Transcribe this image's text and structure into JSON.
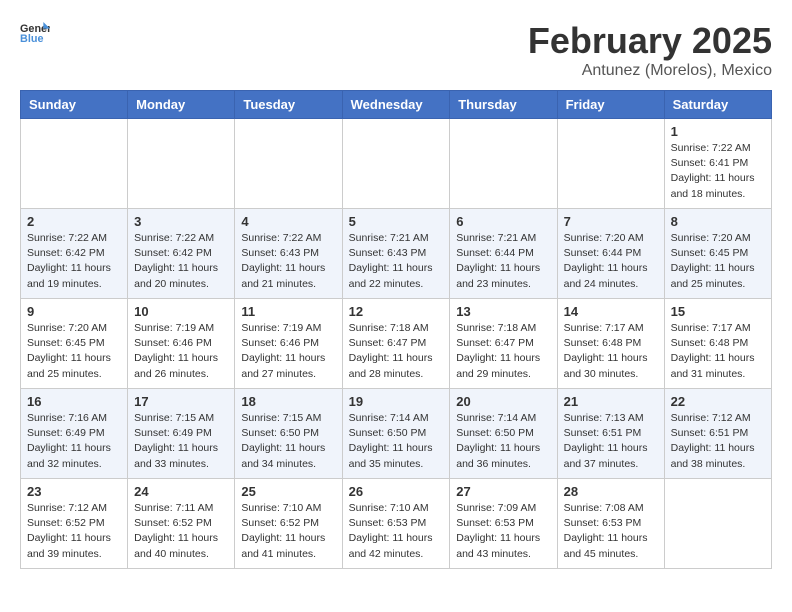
{
  "logo": {
    "general": "General",
    "blue": "Blue"
  },
  "header": {
    "month": "February 2025",
    "location": "Antunez (Morelos), Mexico"
  },
  "weekdays": [
    "Sunday",
    "Monday",
    "Tuesday",
    "Wednesday",
    "Thursday",
    "Friday",
    "Saturday"
  ],
  "weeks": [
    [
      {
        "day": "",
        "info": ""
      },
      {
        "day": "",
        "info": ""
      },
      {
        "day": "",
        "info": ""
      },
      {
        "day": "",
        "info": ""
      },
      {
        "day": "",
        "info": ""
      },
      {
        "day": "",
        "info": ""
      },
      {
        "day": "1",
        "info": "Sunrise: 7:22 AM\nSunset: 6:41 PM\nDaylight: 11 hours and 18 minutes."
      }
    ],
    [
      {
        "day": "2",
        "info": "Sunrise: 7:22 AM\nSunset: 6:42 PM\nDaylight: 11 hours and 19 minutes."
      },
      {
        "day": "3",
        "info": "Sunrise: 7:22 AM\nSunset: 6:42 PM\nDaylight: 11 hours and 20 minutes."
      },
      {
        "day": "4",
        "info": "Sunrise: 7:22 AM\nSunset: 6:43 PM\nDaylight: 11 hours and 21 minutes."
      },
      {
        "day": "5",
        "info": "Sunrise: 7:21 AM\nSunset: 6:43 PM\nDaylight: 11 hours and 22 minutes."
      },
      {
        "day": "6",
        "info": "Sunrise: 7:21 AM\nSunset: 6:44 PM\nDaylight: 11 hours and 23 minutes."
      },
      {
        "day": "7",
        "info": "Sunrise: 7:20 AM\nSunset: 6:44 PM\nDaylight: 11 hours and 24 minutes."
      },
      {
        "day": "8",
        "info": "Sunrise: 7:20 AM\nSunset: 6:45 PM\nDaylight: 11 hours and 25 minutes."
      }
    ],
    [
      {
        "day": "9",
        "info": "Sunrise: 7:20 AM\nSunset: 6:45 PM\nDaylight: 11 hours and 25 minutes."
      },
      {
        "day": "10",
        "info": "Sunrise: 7:19 AM\nSunset: 6:46 PM\nDaylight: 11 hours and 26 minutes."
      },
      {
        "day": "11",
        "info": "Sunrise: 7:19 AM\nSunset: 6:46 PM\nDaylight: 11 hours and 27 minutes."
      },
      {
        "day": "12",
        "info": "Sunrise: 7:18 AM\nSunset: 6:47 PM\nDaylight: 11 hours and 28 minutes."
      },
      {
        "day": "13",
        "info": "Sunrise: 7:18 AM\nSunset: 6:47 PM\nDaylight: 11 hours and 29 minutes."
      },
      {
        "day": "14",
        "info": "Sunrise: 7:17 AM\nSunset: 6:48 PM\nDaylight: 11 hours and 30 minutes."
      },
      {
        "day": "15",
        "info": "Sunrise: 7:17 AM\nSunset: 6:48 PM\nDaylight: 11 hours and 31 minutes."
      }
    ],
    [
      {
        "day": "16",
        "info": "Sunrise: 7:16 AM\nSunset: 6:49 PM\nDaylight: 11 hours and 32 minutes."
      },
      {
        "day": "17",
        "info": "Sunrise: 7:15 AM\nSunset: 6:49 PM\nDaylight: 11 hours and 33 minutes."
      },
      {
        "day": "18",
        "info": "Sunrise: 7:15 AM\nSunset: 6:50 PM\nDaylight: 11 hours and 34 minutes."
      },
      {
        "day": "19",
        "info": "Sunrise: 7:14 AM\nSunset: 6:50 PM\nDaylight: 11 hours and 35 minutes."
      },
      {
        "day": "20",
        "info": "Sunrise: 7:14 AM\nSunset: 6:50 PM\nDaylight: 11 hours and 36 minutes."
      },
      {
        "day": "21",
        "info": "Sunrise: 7:13 AM\nSunset: 6:51 PM\nDaylight: 11 hours and 37 minutes."
      },
      {
        "day": "22",
        "info": "Sunrise: 7:12 AM\nSunset: 6:51 PM\nDaylight: 11 hours and 38 minutes."
      }
    ],
    [
      {
        "day": "23",
        "info": "Sunrise: 7:12 AM\nSunset: 6:52 PM\nDaylight: 11 hours and 39 minutes."
      },
      {
        "day": "24",
        "info": "Sunrise: 7:11 AM\nSunset: 6:52 PM\nDaylight: 11 hours and 40 minutes."
      },
      {
        "day": "25",
        "info": "Sunrise: 7:10 AM\nSunset: 6:52 PM\nDaylight: 11 hours and 41 minutes."
      },
      {
        "day": "26",
        "info": "Sunrise: 7:10 AM\nSunset: 6:53 PM\nDaylight: 11 hours and 42 minutes."
      },
      {
        "day": "27",
        "info": "Sunrise: 7:09 AM\nSunset: 6:53 PM\nDaylight: 11 hours and 43 minutes."
      },
      {
        "day": "28",
        "info": "Sunrise: 7:08 AM\nSunset: 6:53 PM\nDaylight: 11 hours and 45 minutes."
      },
      {
        "day": "",
        "info": ""
      }
    ]
  ]
}
